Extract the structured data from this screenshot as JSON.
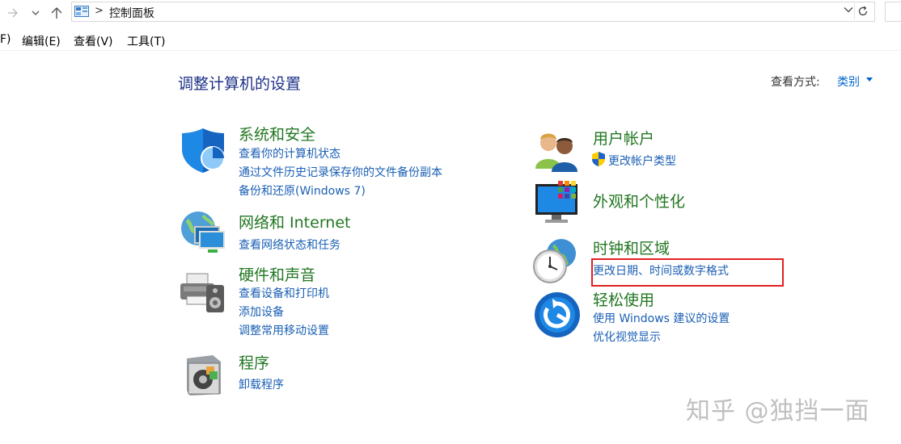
{
  "address_bar": {
    "path": "控制面板"
  },
  "menu": {
    "items": [
      "F)",
      "编辑(E)",
      "查看(V)",
      "工具(T)"
    ]
  },
  "page": {
    "title": "调整计算机的设置",
    "view_by_label": "查看方式:",
    "view_by_value": "类别"
  },
  "categories": {
    "system_security": {
      "title": "系统和安全",
      "icon": "shield-icon",
      "links": [
        "查看你的计算机状态",
        "通过文件历史记录保存你的文件备份副本",
        "备份和还原(Windows 7)"
      ]
    },
    "network": {
      "title": "网络和 Internet",
      "icon": "network-globe-icon",
      "links": [
        "查看网络状态和任务"
      ]
    },
    "hardware_sound": {
      "title": "硬件和声音",
      "icon": "printer-speaker-icon",
      "links": [
        "查看设备和打印机",
        "添加设备",
        "调整常用移动设置"
      ]
    },
    "programs": {
      "title": "程序",
      "icon": "programs-box-icon",
      "links": [
        "卸载程序"
      ]
    },
    "user_accounts": {
      "title": "用户帐户",
      "icon": "users-icon",
      "links": [
        "更改帐户类型"
      ]
    },
    "appearance": {
      "title": "外观和个性化",
      "icon": "monitor-personalize-icon",
      "links": []
    },
    "clock_region": {
      "title": "时钟和区域",
      "icon": "clock-globe-icon",
      "links": [
        "更改日期、时间或数字格式"
      ]
    },
    "ease_of_access": {
      "title": "轻松使用",
      "icon": "ease-of-access-icon",
      "links": [
        "使用 Windows 建议的设置",
        "优化视觉显示"
      ]
    }
  },
  "watermark": "知乎 @独挡一面",
  "colors": {
    "category_title": "#227722",
    "link": "#1a5fb4",
    "heading": "#1e3287",
    "highlight": "#e02020"
  }
}
